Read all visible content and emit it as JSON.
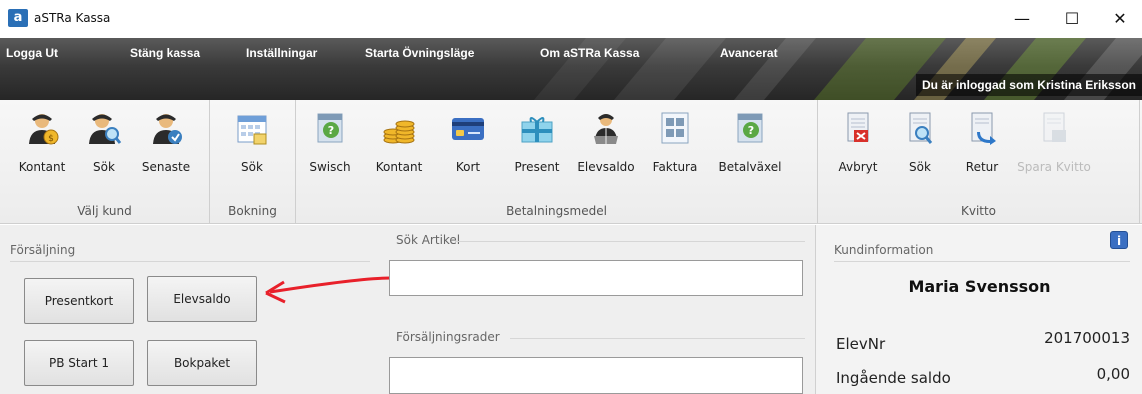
{
  "window": {
    "title": "aSTRa Kassa",
    "icon_letter": "a",
    "minimize": "—",
    "maximize": "☐",
    "close": "✕"
  },
  "menu": {
    "items": [
      "Logga Ut",
      "Stäng kassa",
      "Inställningar",
      "Starta Övningsläge",
      "Om aSTRa Kassa",
      "Avancerat"
    ],
    "logged_in": "Du är inloggad som Kristina Eriksson"
  },
  "ribbon": {
    "groups": [
      {
        "label": "Välj kund",
        "buttons": [
          {
            "label": "Kontant",
            "icon": "person-icon"
          },
          {
            "label": "Sök",
            "icon": "person-search-icon"
          },
          {
            "label": "Senaste",
            "icon": "person-recent-icon"
          }
        ]
      },
      {
        "label": "Bokning",
        "buttons": [
          {
            "label": "Sök",
            "icon": "calendar-icon"
          }
        ]
      },
      {
        "label": "Betalningsmedel",
        "buttons": [
          {
            "label": "Swisch",
            "icon": "swish-icon"
          },
          {
            "label": "Kontant",
            "icon": "coins-icon"
          },
          {
            "label": "Kort",
            "icon": "card-icon"
          },
          {
            "label": "Present",
            "icon": "gift-icon"
          },
          {
            "label": "Elevsaldo",
            "icon": "student-balance-icon"
          },
          {
            "label": "Faktura",
            "icon": "invoice-icon"
          },
          {
            "label": "Betalväxel",
            "icon": "payment-exchange-icon"
          }
        ]
      },
      {
        "label": "Kvitto",
        "buttons": [
          {
            "label": "Avbryt",
            "icon": "cancel-receipt-icon"
          },
          {
            "label": "Sök",
            "icon": "search-receipt-icon"
          },
          {
            "label": "Retur",
            "icon": "return-receipt-icon"
          },
          {
            "label": "Spara Kvitto",
            "icon": "save-receipt-icon",
            "disabled": true
          }
        ]
      }
    ]
  },
  "sales": {
    "title": "Försäljning",
    "buttons": [
      "Presentkort",
      "Elevsaldo",
      "PB Start 1",
      "Bokpaket"
    ]
  },
  "article": {
    "search_title": "Sök Artikel",
    "rows_title": "Försäljningsrader",
    "search_value": ""
  },
  "customer": {
    "title": "Kundinformation",
    "info_icon": "i",
    "name": "Maria Svensson",
    "fields": [
      {
        "label": "ElevNr",
        "value": "201700013"
      },
      {
        "label": "Ingående saldo",
        "value": "0,00"
      }
    ]
  },
  "colors": {
    "arrow": "#e8202a",
    "accent_blue": "#3b6fc2",
    "menubar": "#2e2e2e"
  }
}
